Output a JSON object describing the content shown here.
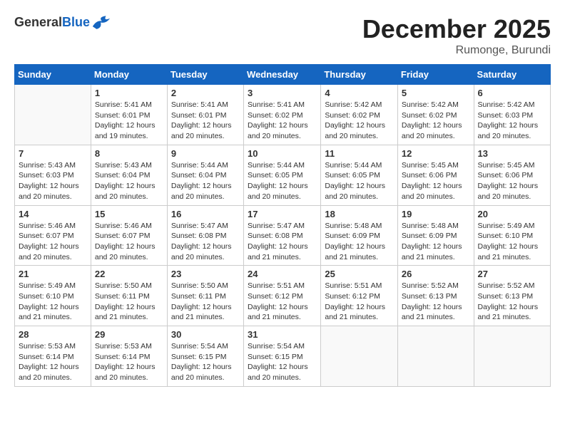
{
  "logo": {
    "general": "General",
    "blue": "Blue"
  },
  "title": "December 2025",
  "subtitle": "Rumonge, Burundi",
  "days_header": [
    "Sunday",
    "Monday",
    "Tuesday",
    "Wednesday",
    "Thursday",
    "Friday",
    "Saturday"
  ],
  "weeks": [
    [
      {
        "day": "",
        "info": ""
      },
      {
        "day": "1",
        "info": "Sunrise: 5:41 AM\nSunset: 6:01 PM\nDaylight: 12 hours\nand 19 minutes."
      },
      {
        "day": "2",
        "info": "Sunrise: 5:41 AM\nSunset: 6:01 PM\nDaylight: 12 hours\nand 20 minutes."
      },
      {
        "day": "3",
        "info": "Sunrise: 5:41 AM\nSunset: 6:02 PM\nDaylight: 12 hours\nand 20 minutes."
      },
      {
        "day": "4",
        "info": "Sunrise: 5:42 AM\nSunset: 6:02 PM\nDaylight: 12 hours\nand 20 minutes."
      },
      {
        "day": "5",
        "info": "Sunrise: 5:42 AM\nSunset: 6:02 PM\nDaylight: 12 hours\nand 20 minutes."
      },
      {
        "day": "6",
        "info": "Sunrise: 5:42 AM\nSunset: 6:03 PM\nDaylight: 12 hours\nand 20 minutes."
      }
    ],
    [
      {
        "day": "7",
        "info": ""
      },
      {
        "day": "8",
        "info": "Sunrise: 5:43 AM\nSunset: 6:04 PM\nDaylight: 12 hours\nand 20 minutes."
      },
      {
        "day": "9",
        "info": "Sunrise: 5:44 AM\nSunset: 6:04 PM\nDaylight: 12 hours\nand 20 minutes."
      },
      {
        "day": "10",
        "info": "Sunrise: 5:44 AM\nSunset: 6:05 PM\nDaylight: 12 hours\nand 20 minutes."
      },
      {
        "day": "11",
        "info": "Sunrise: 5:44 AM\nSunset: 6:05 PM\nDaylight: 12 hours\nand 20 minutes."
      },
      {
        "day": "12",
        "info": "Sunrise: 5:45 AM\nSunset: 6:06 PM\nDaylight: 12 hours\nand 20 minutes."
      },
      {
        "day": "13",
        "info": "Sunrise: 5:45 AM\nSunset: 6:06 PM\nDaylight: 12 hours\nand 20 minutes."
      }
    ],
    [
      {
        "day": "14",
        "info": ""
      },
      {
        "day": "15",
        "info": "Sunrise: 5:46 AM\nSunset: 6:07 PM\nDaylight: 12 hours\nand 20 minutes."
      },
      {
        "day": "16",
        "info": "Sunrise: 5:47 AM\nSunset: 6:08 PM\nDaylight: 12 hours\nand 20 minutes."
      },
      {
        "day": "17",
        "info": "Sunrise: 5:47 AM\nSunset: 6:08 PM\nDaylight: 12 hours\nand 21 minutes."
      },
      {
        "day": "18",
        "info": "Sunrise: 5:48 AM\nSunset: 6:09 PM\nDaylight: 12 hours\nand 21 minutes."
      },
      {
        "day": "19",
        "info": "Sunrise: 5:48 AM\nSunset: 6:09 PM\nDaylight: 12 hours\nand 21 minutes."
      },
      {
        "day": "20",
        "info": "Sunrise: 5:49 AM\nSunset: 6:10 PM\nDaylight: 12 hours\nand 21 minutes."
      }
    ],
    [
      {
        "day": "21",
        "info": ""
      },
      {
        "day": "22",
        "info": "Sunrise: 5:50 AM\nSunset: 6:11 PM\nDaylight: 12 hours\nand 21 minutes."
      },
      {
        "day": "23",
        "info": "Sunrise: 5:50 AM\nSunset: 6:11 PM\nDaylight: 12 hours\nand 21 minutes."
      },
      {
        "day": "24",
        "info": "Sunrise: 5:51 AM\nSunset: 6:12 PM\nDaylight: 12 hours\nand 21 minutes."
      },
      {
        "day": "25",
        "info": "Sunrise: 5:51 AM\nSunset: 6:12 PM\nDaylight: 12 hours\nand 21 minutes."
      },
      {
        "day": "26",
        "info": "Sunrise: 5:52 AM\nSunset: 6:13 PM\nDaylight: 12 hours\nand 21 minutes."
      },
      {
        "day": "27",
        "info": "Sunrise: 5:52 AM\nSunset: 6:13 PM\nDaylight: 12 hours\nand 21 minutes."
      }
    ],
    [
      {
        "day": "28",
        "info": "Sunrise: 5:53 AM\nSunset: 6:14 PM\nDaylight: 12 hours\nand 20 minutes."
      },
      {
        "day": "29",
        "info": "Sunrise: 5:53 AM\nSunset: 6:14 PM\nDaylight: 12 hours\nand 20 minutes."
      },
      {
        "day": "30",
        "info": "Sunrise: 5:54 AM\nSunset: 6:15 PM\nDaylight: 12 hours\nand 20 minutes."
      },
      {
        "day": "31",
        "info": "Sunrise: 5:54 AM\nSunset: 6:15 PM\nDaylight: 12 hours\nand 20 minutes."
      },
      {
        "day": "",
        "info": ""
      },
      {
        "day": "",
        "info": ""
      },
      {
        "day": "",
        "info": ""
      }
    ]
  ],
  "week7_sunday": {
    "info": "Sunrise: 5:43 AM\nSunset: 6:03 PM\nDaylight: 12 hours\nand 20 minutes."
  },
  "week14_sunday": {
    "info": "Sunrise: 5:46 AM\nSunset: 6:07 PM\nDaylight: 12 hours\nand 20 minutes."
  },
  "week21_sunday": {
    "info": "Sunrise: 5:49 AM\nSunset: 6:10 PM\nDaylight: 12 hours\nand 21 minutes."
  }
}
